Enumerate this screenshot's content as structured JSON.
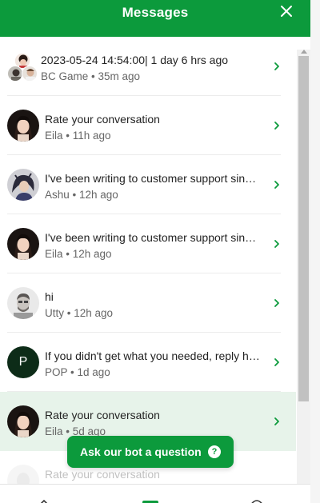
{
  "header": {
    "title": "Messages",
    "close_icon": "close-icon"
  },
  "conversations": [
    {
      "message": "2023-05-24 14:54:00| 1 day 6 hrs ago",
      "sender": "BC Game",
      "time": "35m ago",
      "avatar": "group-avatar"
    },
    {
      "message": "Rate your conversation",
      "sender": "Eila",
      "time": "11h ago",
      "avatar": "eila-avatar"
    },
    {
      "message": "I've been writing to customer support since morning",
      "sender": "Ashu",
      "time": "12h ago",
      "avatar": "ashu-avatar"
    },
    {
      "message": "I've been writing to customer support since morning",
      "sender": "Eila",
      "time": "12h ago",
      "avatar": "eila-avatar"
    },
    {
      "message": "hi",
      "sender": "Utty",
      "time": "12h ago",
      "avatar": "utty-avatar"
    },
    {
      "message": "If you didn't get what you needed, reply here",
      "sender": "POP",
      "time": "1d ago",
      "avatar": "pop-avatar",
      "initial": "P"
    },
    {
      "message": "Rate your conversation",
      "sender": "Eila",
      "time": "5d ago",
      "avatar": "eila-avatar"
    },
    {
      "message": "Rate your conversation",
      "sender": "",
      "time": "",
      "avatar": "partial-avatar"
    }
  ],
  "bot_button": {
    "label": "Ask our bot a question",
    "icon": "question-icon"
  },
  "colors": {
    "accent": "#0c9a3c",
    "highlight_row": "#e7f3ea"
  }
}
